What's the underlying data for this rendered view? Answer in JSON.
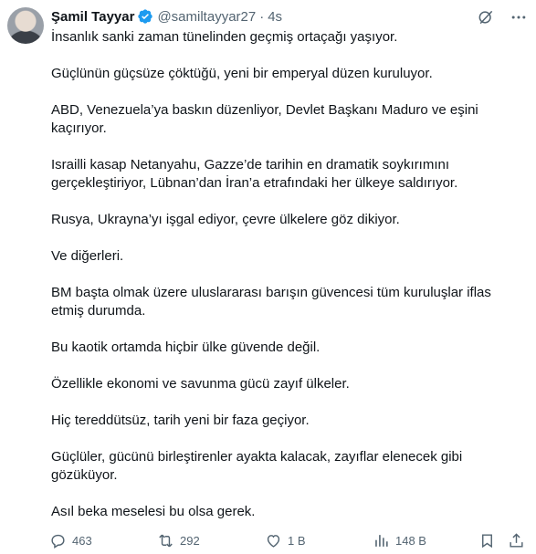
{
  "author": {
    "name": "Şamil Tayyar",
    "handle": "@samiltayyar27",
    "time": "4s",
    "separator": "·"
  },
  "tweet": {
    "paragraphs": [
      "İnsanlık sanki zaman tünelinden geçmiş ortaçağı yaşıyor.",
      "Güçlünün güçsüze çöktüğü, yeni bir emperyal düzen kuruluyor.",
      "ABD, Venezuela’ya baskın düzenliyor, Devlet Başkanı Maduro ve eşini kaçırıyor.",
      "Israilli kasap Netanyahu, Gazze’de tarihin en dramatik soykırımını gerçekleştiriyor, Lübnan’dan İran’a etrafındaki her ülkeye saldırıyor.",
      "Rusya, Ukrayna’yı işgal ediyor, çevre ülkelere göz dikiyor.",
      "Ve diğerleri.",
      "BM başta olmak üzere uluslararası barışın güvencesi tüm kuruluşlar iflas etmiş durumda.",
      "Bu kaotik ortamda hiçbir ülke güvende değil.",
      "Özellikle ekonomi ve savunma gücü zayıf ülkeler.",
      "Hiç tereddütsüz, tarih yeni bir faza geçiyor.",
      "Güçlüler, gücünü birleştirenler ayakta kalacak, zayıflar elenecek gibi gözüküyor.",
      "Asıl beka meselesi bu olsa gerek."
    ]
  },
  "stats": {
    "replies": "463",
    "retweets": "292",
    "likes": "1 B",
    "views": "148 B"
  },
  "icons": {
    "verified": "verified-badge-icon",
    "grok": "grok-icon",
    "more": "more-icon",
    "reply": "reply-icon",
    "retweet": "retweet-icon",
    "like": "heart-icon",
    "views": "views-icon",
    "bookmark": "bookmark-icon",
    "share": "share-icon"
  },
  "colors": {
    "verified": "#1d9bf0",
    "text": "#0f1419",
    "muted": "#536471"
  }
}
